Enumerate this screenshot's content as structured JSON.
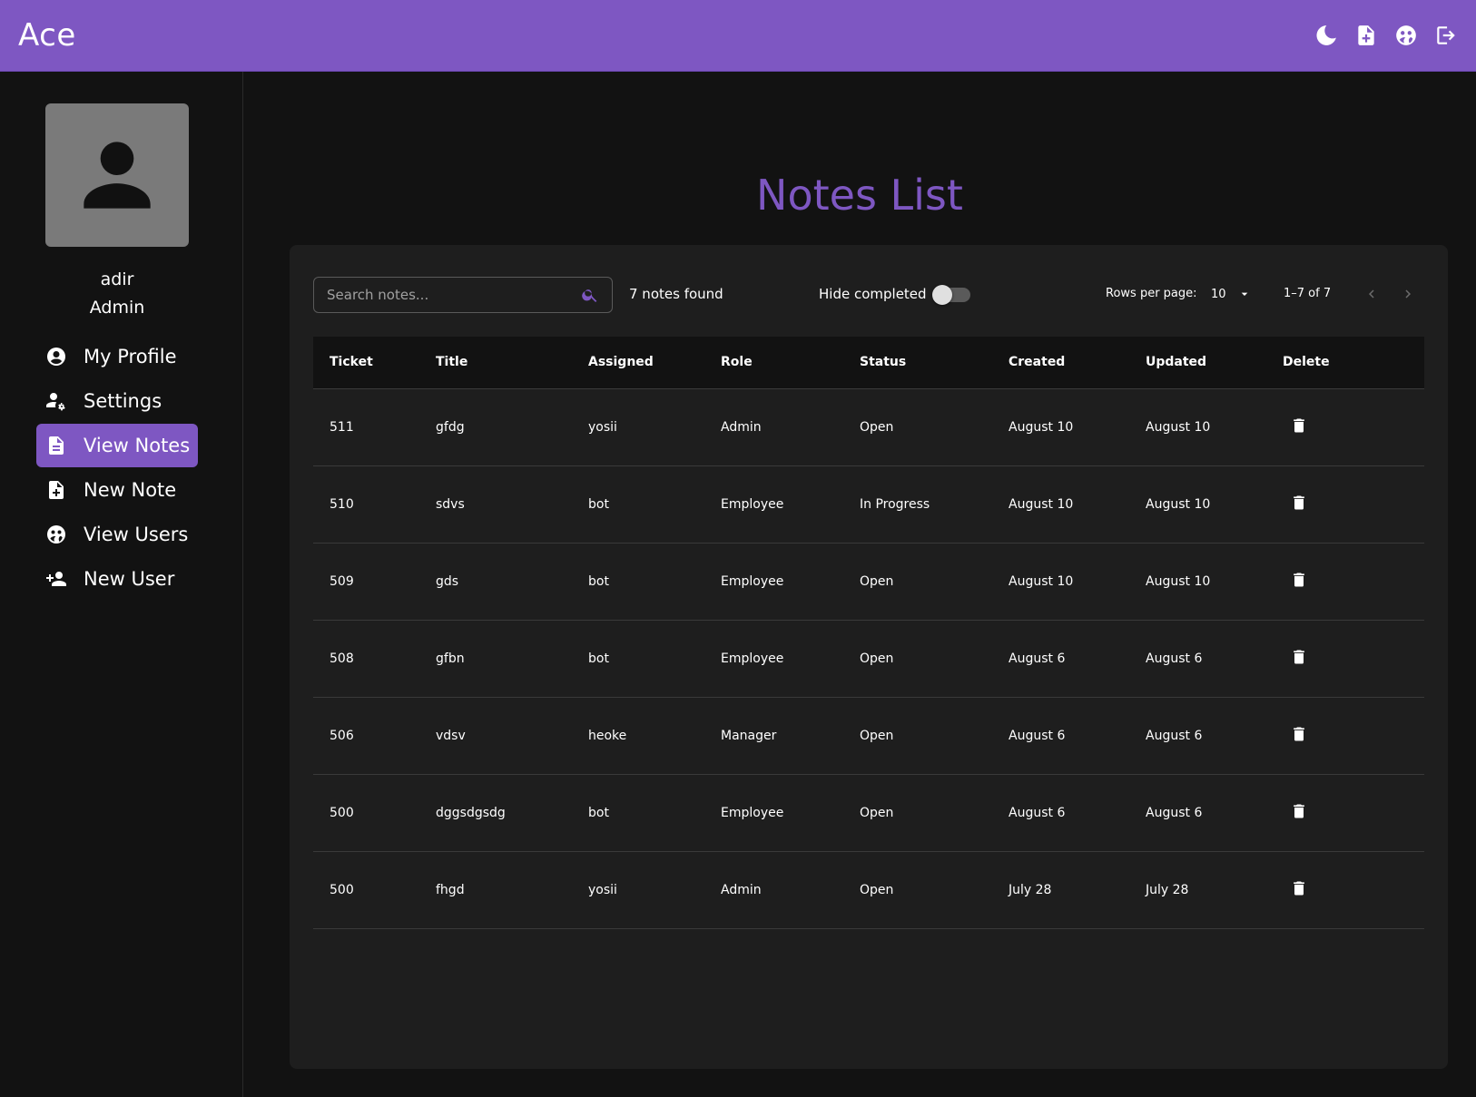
{
  "header": {
    "brand": "Ace",
    "icons": [
      "moon-icon",
      "new-note-icon",
      "users-icon",
      "logout-icon"
    ]
  },
  "sidebar": {
    "user": {
      "name": "adir",
      "role": "Admin"
    },
    "items": [
      {
        "label": "My Profile",
        "icon": "account-circle-icon",
        "active": false
      },
      {
        "label": "Settings",
        "icon": "user-settings-icon",
        "active": false
      },
      {
        "label": "View Notes",
        "icon": "note-icon",
        "active": true
      },
      {
        "label": "New Note",
        "icon": "note-add-icon",
        "active": false
      },
      {
        "label": "View Users",
        "icon": "users-icon",
        "active": false
      },
      {
        "label": "New User",
        "icon": "person-add-icon",
        "active": false
      }
    ]
  },
  "main": {
    "title": "Notes List",
    "search": {
      "placeholder": "Search notes...",
      "value": ""
    },
    "found_text": "7 notes found",
    "hide_completed_label": "Hide completed",
    "hide_completed": false,
    "rows_per_page_label": "Rows per page:",
    "rows_per_page": "10",
    "range": "1–7 of 7",
    "table": {
      "headers": [
        "Ticket",
        "Title",
        "Assigned",
        "Role",
        "Status",
        "Created",
        "Updated",
        "Delete"
      ],
      "rows": [
        [
          "511",
          "gfdg",
          "yosii",
          "Admin",
          "Open",
          "August 10",
          "August 10"
        ],
        [
          "510",
          "sdvs",
          "bot",
          "Employee",
          "In Progress",
          "August 10",
          "August 10"
        ],
        [
          "509",
          "gds",
          "bot",
          "Employee",
          "Open",
          "August 10",
          "August 10"
        ],
        [
          "508",
          "gfbn",
          "bot",
          "Employee",
          "Open",
          "August 6",
          "August 6"
        ],
        [
          "506",
          "vdsv",
          "heoke",
          "Manager",
          "Open",
          "August 6",
          "August 6"
        ],
        [
          "500",
          "dggsdgsdg",
          "bot",
          "Employee",
          "Open",
          "August 6",
          "August 6"
        ],
        [
          "500",
          "fhgd",
          "yosii",
          "Admin",
          "Open",
          "July 28",
          "July 28"
        ]
      ]
    }
  },
  "colors": {
    "accent": "#7e57c2",
    "background": "#121212",
    "panel": "#1e1e1e"
  }
}
